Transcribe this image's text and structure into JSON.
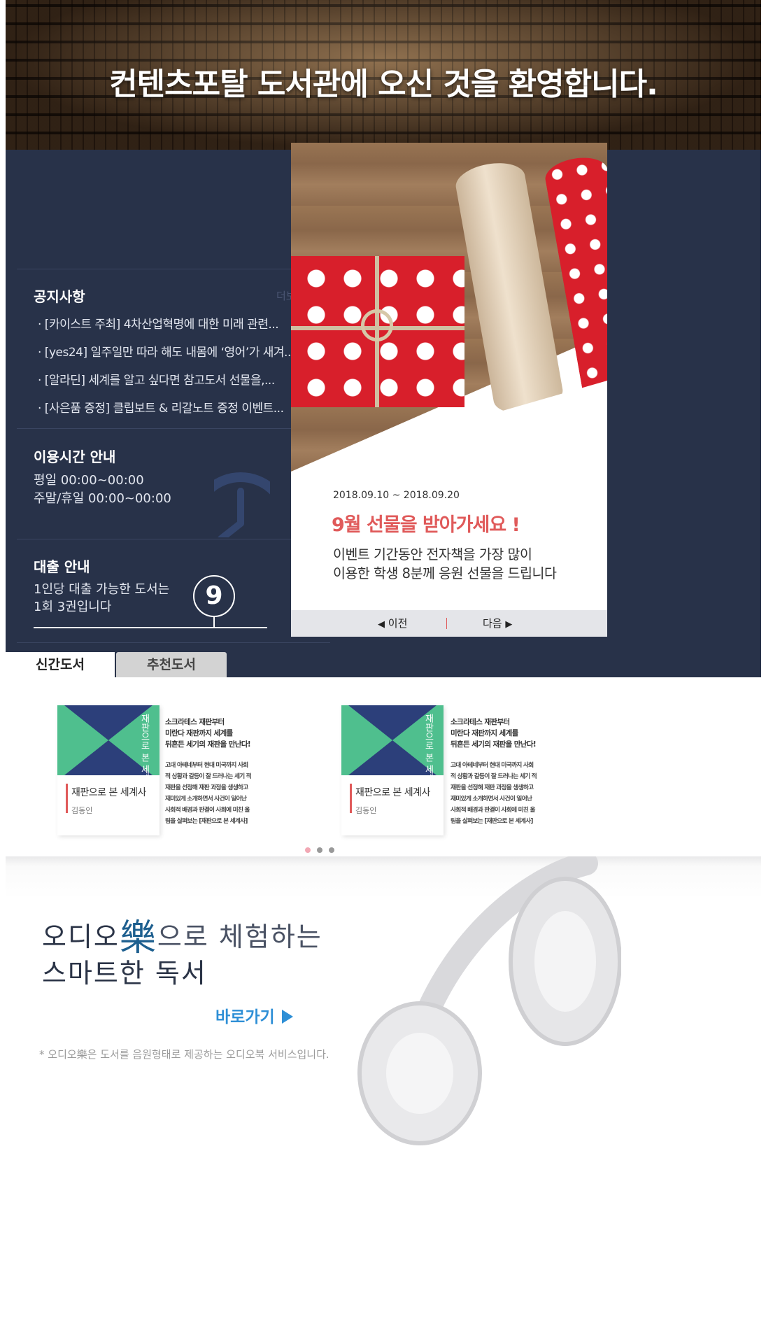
{
  "hero": {
    "title": "컨텐츠포탈 도서관에 오신 것을 환영합니다."
  },
  "notice": {
    "title": "공지사항",
    "more": "더보기+",
    "items": [
      "· [카이스트 주최] 4차산업혁명에 대한 미래 관련...",
      "· [yes24] 일주일만 따라 해도 내몸에 ‘영어’가 새겨...",
      "· [알라딘] 세계를 알고 싶다면 참고도서 선물을,...",
      "· [사은품 증정] 클립보트 & 리갈노트 증정 이벤트..."
    ]
  },
  "hours": {
    "title": "이용시간 안내",
    "weekday": "평일 00:00~00:00",
    "weekend": "주말/휴일 00:00~00:00",
    "icon": "clock-icon"
  },
  "loan": {
    "title": "대출 안내",
    "line1": "1인당 대출 가능한 도서는",
    "line2": "1회 3권입니다",
    "number": "9"
  },
  "event": {
    "date": "2018.09.10 ~ 2018.09.20",
    "heading": "9월 선물을 받아가세요 !",
    "desc1": "이벤트 기간동안 전자책을 가장 많이",
    "desc2": "이용한 학생 8분께 응원 선물을 드립니다",
    "prev": "이전",
    "next": "다음",
    "accent": "#e05a5a"
  },
  "tabs": {
    "new": "신간도서",
    "recommended": "추천도서"
  },
  "books": [
    {
      "cover_title": "재판으로 본 세계사",
      "title": "재판으로 본 세계사",
      "author": "김동인",
      "blurb_head": [
        "소크라테스 재판부터",
        "미란다 재판까지 세계를",
        "뒤흔든 세기의 재판을 만난다!"
      ],
      "blurb_body": [
        "고대 아테네부터 현대 미국까지 사회",
        "적 상황과 갈등이 잘 드러나는 세기 적",
        "재판을 선정해 재판 과정을 생생하고",
        "재미있게 소개하면서 사건이 일어난",
        "사회적 배경과 판결이 사회에 미친 울",
        "림을 살펴보는 [재판으로 본 세계사]"
      ]
    },
    {
      "cover_title": "재판으로 본 세계사",
      "title": "재판으로 본 세계사",
      "author": "김동인",
      "blurb_head": [
        "소크라테스 재판부터",
        "미란다 재판까지 세계를",
        "뒤흔든 세기의 재판을 만난다!"
      ],
      "blurb_body": [
        "고대 아테네부터 현대 미국까지 사회",
        "적 상황과 갈등이 잘 드러나는 세기 적",
        "재판을 선정해 재판 과정을 생생하고",
        "재미있게 소개하면서 사건이 일어난",
        "사회적 배경과 판결이 사회에 미친 울",
        "림을 살펴보는 [재판으로 본 세계사]"
      ]
    }
  ],
  "carousel": {
    "pages": 3,
    "active": 1
  },
  "audio": {
    "line1_a": "오디오",
    "line1_char": "樂",
    "line1_b": "으로 체험하는",
    "line2": "스마트한 독서",
    "go": "바로가기",
    "note": "* 오디오樂은 도서를 음원형태로 제공하는 오디오북 서비스입니다."
  }
}
